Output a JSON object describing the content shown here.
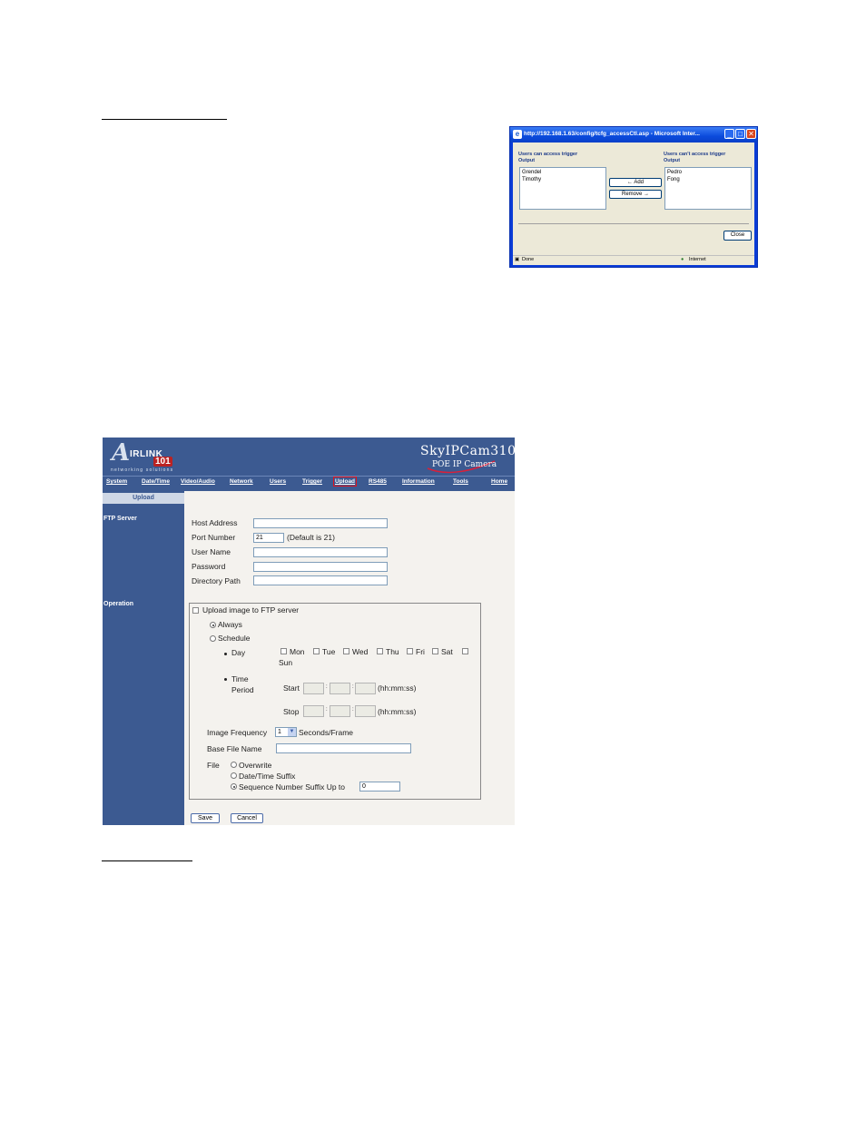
{
  "popup": {
    "title": "http://192.168.1.63/config/tcfg_accessCtl.asp - Microsoft Inter...",
    "left_heading_1": "Users can access trigger",
    "left_heading_2": "Output",
    "right_heading_1": "Users can't access trigger",
    "right_heading_2": "Output",
    "left_users": [
      "Grendel",
      "Timothy"
    ],
    "right_users": [
      "Pedro",
      "Fong"
    ],
    "add_label": "← Add",
    "remove_label": "Remove →",
    "close_label": "Close",
    "status_left": "Done",
    "status_right": "Internet"
  },
  "camera": {
    "brand_letter": "A",
    "brand_rest": "IRLINK",
    "brand_num": "101",
    "tagline": "networking solutions",
    "model": "SkyIPCam310",
    "submodel": "POE IP Camera",
    "nav": [
      "System",
      "Date/Time",
      "Video/Audio",
      "Network",
      "Users",
      "Trigger",
      "Upload",
      "RS485",
      "Information",
      "Tools",
      "Home"
    ],
    "active_nav": "Upload",
    "side_header": "Upload",
    "side_ftp": "FTP Server",
    "side_operation": "Operation",
    "ftp": {
      "host_label": "Host Address",
      "host_value": "",
      "port_label": "Port Number",
      "port_value": "21",
      "port_hint": "(Default is 21)",
      "user_label": "User Name",
      "user_value": "",
      "password_label": "Password",
      "password_value": "",
      "dir_label": "Directory Path",
      "dir_value": ""
    },
    "operation": {
      "upload_label": "Upload image to FTP server",
      "always_label": "Always",
      "schedule_label": "Schedule",
      "day_label": "Day",
      "days": [
        "Mon",
        "Tue",
        "Wed",
        "Thu",
        "Fri",
        "Sat",
        "Sun"
      ],
      "time_label_1": "Time",
      "time_label_2": "Period",
      "start_label": "Start",
      "stop_label": "Stop",
      "time_hint": "(hh:mm:ss)",
      "freq_label": "Image Frequency",
      "freq_value": "1",
      "freq_unit": "Seconds/Frame",
      "base_label": "Base File Name",
      "base_value": "",
      "file_label": "File",
      "file_options": [
        "Overwrite",
        "Date/Time Suffix",
        "Sequence Number Suffix Up to"
      ],
      "suffix_value": "0"
    },
    "save_label": "Save",
    "cancel_label": "Cancel"
  }
}
